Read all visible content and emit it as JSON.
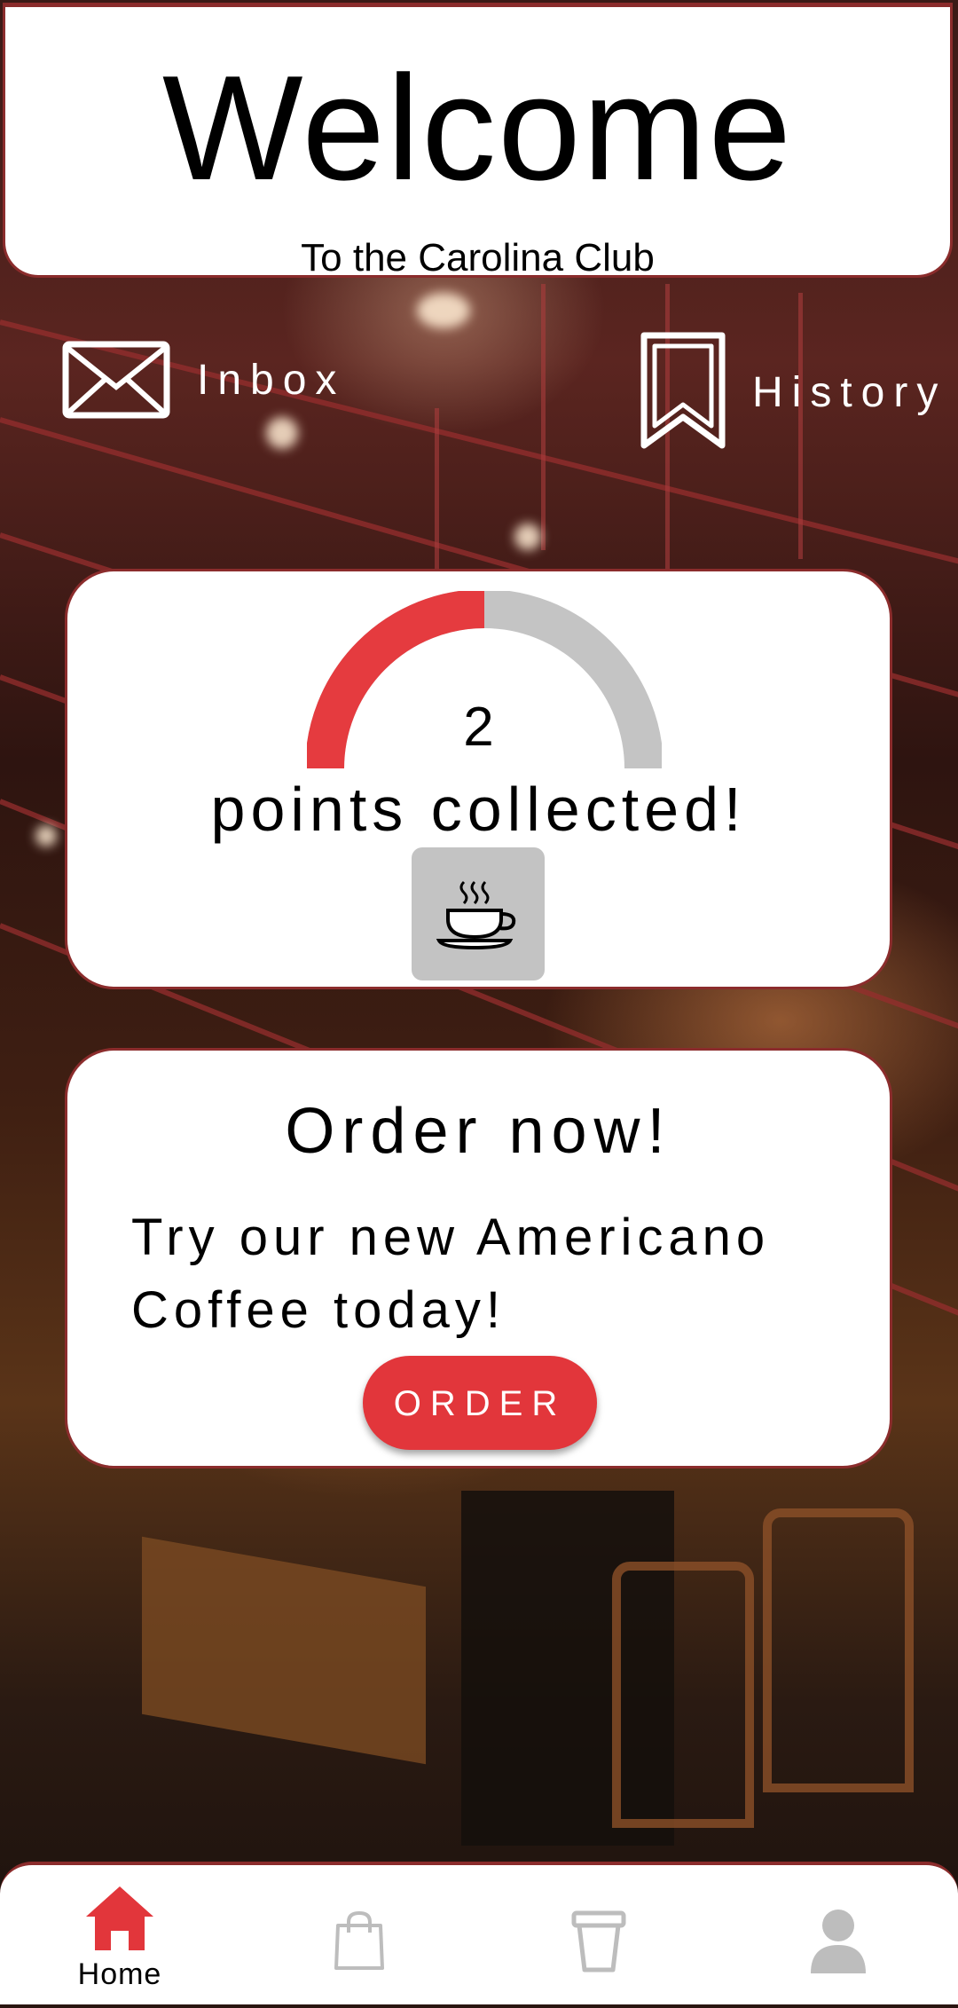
{
  "header": {
    "title": "Welcome",
    "subtitle": "To the Carolina Club"
  },
  "quick_links": {
    "inbox": {
      "label": "Inbox",
      "icon": "envelope-icon"
    },
    "history": {
      "label": "History",
      "icon": "bookmark-icon"
    }
  },
  "points": {
    "value": "2",
    "label": "points collected!",
    "progress_fraction": 0.5,
    "progress_color": "#e53b3f",
    "track_color": "#c4c4c4",
    "reward_icon": "coffee-cup-icon"
  },
  "promo": {
    "title": "Order now!",
    "text_line1": "Try our new Americano",
    "text_line2": "Coffee today!",
    "button_label": "ORDER"
  },
  "nav": {
    "items": [
      {
        "label": "Home",
        "icon": "home-icon",
        "active": true
      },
      {
        "label": "",
        "icon": "shopping-bag-icon",
        "active": false
      },
      {
        "label": "",
        "icon": "cup-icon",
        "active": false
      },
      {
        "label": "",
        "icon": "user-icon",
        "active": false
      }
    ],
    "active_color": "#e2363b",
    "inactive_color": "#bdbdbd"
  },
  "colors": {
    "accent": "#e2363b",
    "card_border": "#8b2c2c"
  }
}
